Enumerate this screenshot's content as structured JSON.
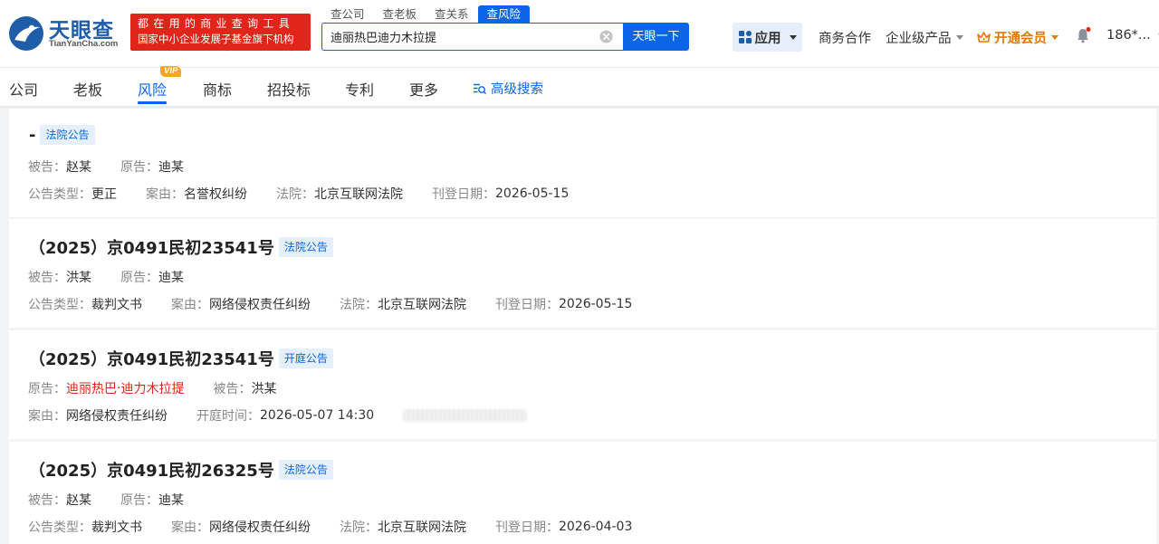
{
  "brand": {
    "name_cn": "天眼查",
    "name_en": "TianYanCha.com",
    "slogan_line1": "都在用的商业查询工具",
    "slogan_line2": "国家中小企业发展子基金旗下机构",
    "logo_color": "#1f5da9",
    "slogan_bg": "#e1251b"
  },
  "search": {
    "tabs": [
      {
        "label": "查公司",
        "active": false
      },
      {
        "label": "查老板",
        "active": false
      },
      {
        "label": "查关系",
        "active": false
      },
      {
        "label": "查风险",
        "active": true
      }
    ],
    "value": "迪丽热巴迪力木拉提",
    "button_label": "天眼一下"
  },
  "top_nav": {
    "apps_label": "应用",
    "business_label": "商务合作",
    "enterprise_label": "企业级产品",
    "vip_label": "开通会员",
    "user_label": "186*..."
  },
  "categories": {
    "tabs": [
      {
        "label": "公司"
      },
      {
        "label": "老板"
      },
      {
        "label": "风险",
        "active": true
      },
      {
        "label": "商标"
      },
      {
        "label": "招投标"
      },
      {
        "label": "专利"
      },
      {
        "label": "更多"
      }
    ],
    "vip_badge": "VIP",
    "advanced_search": "高级搜索"
  },
  "results": [
    {
      "title": "-",
      "tag": "法院公告",
      "line1": {
        "l1": "被告：",
        "v1": "赵某",
        "l2": "原告：",
        "v2": "迪某"
      },
      "line2": {
        "l1": "公告类型：",
        "v1": "更正",
        "l2": "案由：",
        "v2": "名誉权纠纷",
        "l3": "法院：",
        "v3": "北京互联网法院",
        "l4": "刊登日期：",
        "v4": "2026-05-15"
      }
    },
    {
      "title": "（2025）京0491民初23541号",
      "tag": "法院公告",
      "line1": {
        "l1": "被告：",
        "v1": "洪某",
        "l2": "原告：",
        "v2": "迪某"
      },
      "line2": {
        "l1": "公告类型：",
        "v1": "裁判文书",
        "l2": "案由：",
        "v2": "网络侵权责任纠纷",
        "l3": "法院：",
        "v3": "北京互联网法院",
        "l4": "刊登日期：",
        "v4": "2026-05-15"
      }
    },
    {
      "title": "（2025）京0491民初23541号",
      "tag": "开庭公告",
      "line1": {
        "l1": "原告：",
        "v1a": "迪丽热巴",
        "sep": "·",
        "v1b": "迪力木拉提",
        "l2": "被告：",
        "v2": "洪某"
      },
      "line2": {
        "l1": "案由：",
        "v1": "网络侵权责任纠纷",
        "l2": "开庭时间：",
        "v2": "2026-05-07 14:30"
      }
    },
    {
      "title": "（2025）京0491民初26325号",
      "tag": "法院公告",
      "line1": {
        "l1": "被告：",
        "v1": "赵某",
        "l2": "原告：",
        "v2": "迪某"
      },
      "line2": {
        "l1": "公告类型：",
        "v1": "裁判文书",
        "l2": "案由：",
        "v2": "网络侵权责任纠纷",
        "l3": "法院：",
        "v3": "北京互联网法院",
        "l4": "刊登日期：",
        "v4": "2026-04-03"
      }
    }
  ],
  "colors": {
    "accent": "#0a66e6",
    "highlight": "#e1251b",
    "vip": "#e07b00"
  }
}
